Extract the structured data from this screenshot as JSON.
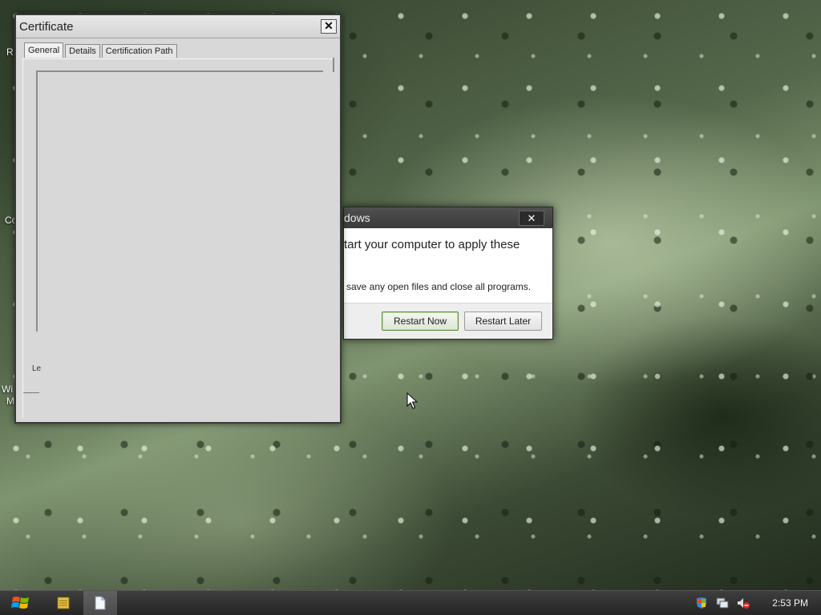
{
  "desktop": {
    "fragments": [
      "R",
      "Co",
      "Wi",
      "M"
    ]
  },
  "certificate_dialog": {
    "title": "Certificate",
    "close_glyph": "✕",
    "tabs": [
      {
        "label": "General",
        "active": true
      },
      {
        "label": "Details",
        "active": false
      },
      {
        "label": "Certification Path",
        "active": false
      }
    ],
    "partial_link_text": "Le"
  },
  "restart_dialog": {
    "title": "dows",
    "close_glyph": "✕",
    "message": "tart your computer to apply these",
    "submessage": "save any open files and close all programs.",
    "restart_now_label": "Restart Now",
    "restart_later_label": "Restart Later"
  },
  "taskbar": {
    "start_icon": "windows-logo-icon",
    "pinned": [
      {
        "name": "notes-icon",
        "active": false
      },
      {
        "name": "document-icon",
        "active": true
      }
    ],
    "tray": [
      "security-flag-icon",
      "network-icon",
      "volume-muted-icon"
    ],
    "clock": "2:53 PM"
  },
  "colors": {
    "taskbar_bg": "#2e2e2e",
    "primary_button_border": "#5a8a3a",
    "dialog_bg": "#d8d8d8"
  }
}
